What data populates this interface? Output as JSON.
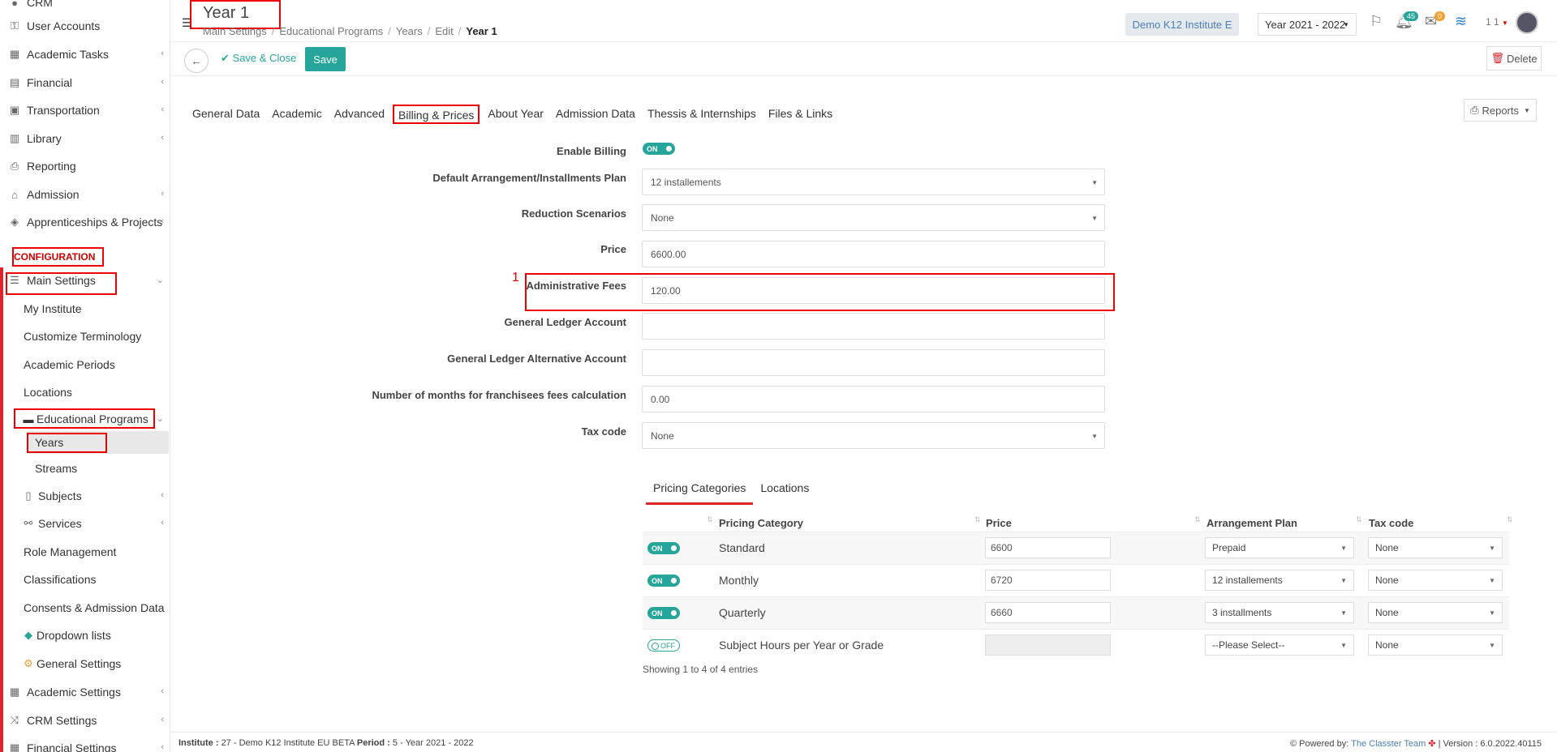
{
  "sidebar": {
    "top_partial": "CRM",
    "items": [
      {
        "label": "User Accounts",
        "icon": "key-icon"
      },
      {
        "label": "Academic Tasks",
        "icon": "grid-icon"
      },
      {
        "label": "Financial",
        "icon": "money-icon"
      },
      {
        "label": "Transportation",
        "icon": "bus-icon"
      },
      {
        "label": "Library",
        "icon": "books-icon"
      },
      {
        "label": "Reporting",
        "icon": "print-icon"
      },
      {
        "label": "Admission",
        "icon": "institution-icon"
      },
      {
        "label": "Apprenticeships & Projects",
        "icon": "cube-icon"
      }
    ],
    "config_label": "CONFIGURATION",
    "main_settings": "Main Settings",
    "main_sub": [
      "My Institute",
      "Customize Terminology",
      "Academic Periods",
      "Locations"
    ],
    "educational_programs": "Educational Programs",
    "edu_sub": [
      "Years",
      "Streams"
    ],
    "main_sub2": [
      "Subjects",
      "Services",
      "Role Management",
      "Classifications",
      "Consents & Admission Data",
      "Dropdown lists",
      "General Settings"
    ],
    "bottom": [
      "Academic Settings",
      "CRM Settings",
      "Financial Settings"
    ]
  },
  "header": {
    "title": "Year 1",
    "breadcrumb": [
      "Main Settings",
      "Educational Programs",
      "Years",
      "Edit",
      "Year 1"
    ],
    "institute": "Demo K12 Institute E",
    "year": "Year 2021 - 2022",
    "notif_count": "45",
    "mail_count": "0",
    "user": "1 1"
  },
  "actions": {
    "save_close": "Save & Close",
    "save": "Save",
    "delete": "Delete"
  },
  "tabs": [
    "General Data",
    "Academic",
    "Advanced",
    "Billing & Prices",
    "About Year",
    "Admission Data",
    "Thessis & Internships",
    "Files & Links"
  ],
  "reports": "Reports",
  "form": {
    "enable_billing_label": "Enable Billing",
    "enable_billing_value": "ON",
    "plan_label": "Default Arrangement/Installments Plan",
    "plan_value": "12 installements",
    "reduction_label": "Reduction Scenarios",
    "reduction_value": "None",
    "price_label": "Price",
    "price_value": "6600.00",
    "admin_fees_label": "Administrative Fees",
    "admin_fees_value": "120.00",
    "gl_label": "General Ledger Account",
    "gl_value": "",
    "gl_alt_label": "General Ledger Alternative Account",
    "gl_alt_value": "",
    "months_label": "Number of months for franchisees fees calculation",
    "months_value": "0.00",
    "tax_label": "Tax code",
    "tax_value": "None",
    "marker": "1"
  },
  "subtabs": [
    "Pricing Categories",
    "Locations"
  ],
  "table": {
    "headers": [
      "Pricing Category",
      "Price",
      "Arrangement Plan",
      "Tax code"
    ],
    "rows": [
      {
        "toggle": "ON",
        "category": "Standard",
        "price": "6600",
        "plan": "Prepaid",
        "tax": "None"
      },
      {
        "toggle": "ON",
        "category": "Monthly",
        "price": "6720",
        "plan": "12 installements",
        "tax": "None"
      },
      {
        "toggle": "ON",
        "category": "Quarterly",
        "price": "6660",
        "plan": "3 installments",
        "tax": "None"
      },
      {
        "toggle": "OFF",
        "category": "Subject Hours per Year or Grade",
        "price": "",
        "plan": "--Please Select--",
        "tax": "None"
      }
    ],
    "showing": "Showing 1 to 4 of 4 entries"
  },
  "footer": {
    "institute_label": "Institute :",
    "institute_value": "27 - Demo K12 Institute EU BETA",
    "period_label": "Period :",
    "period_value": "5 - Year 2021 - 2022",
    "powered": "Powered by:",
    "team": "The Classter Team",
    "version": "| Version : 6.0.2022.40115"
  }
}
